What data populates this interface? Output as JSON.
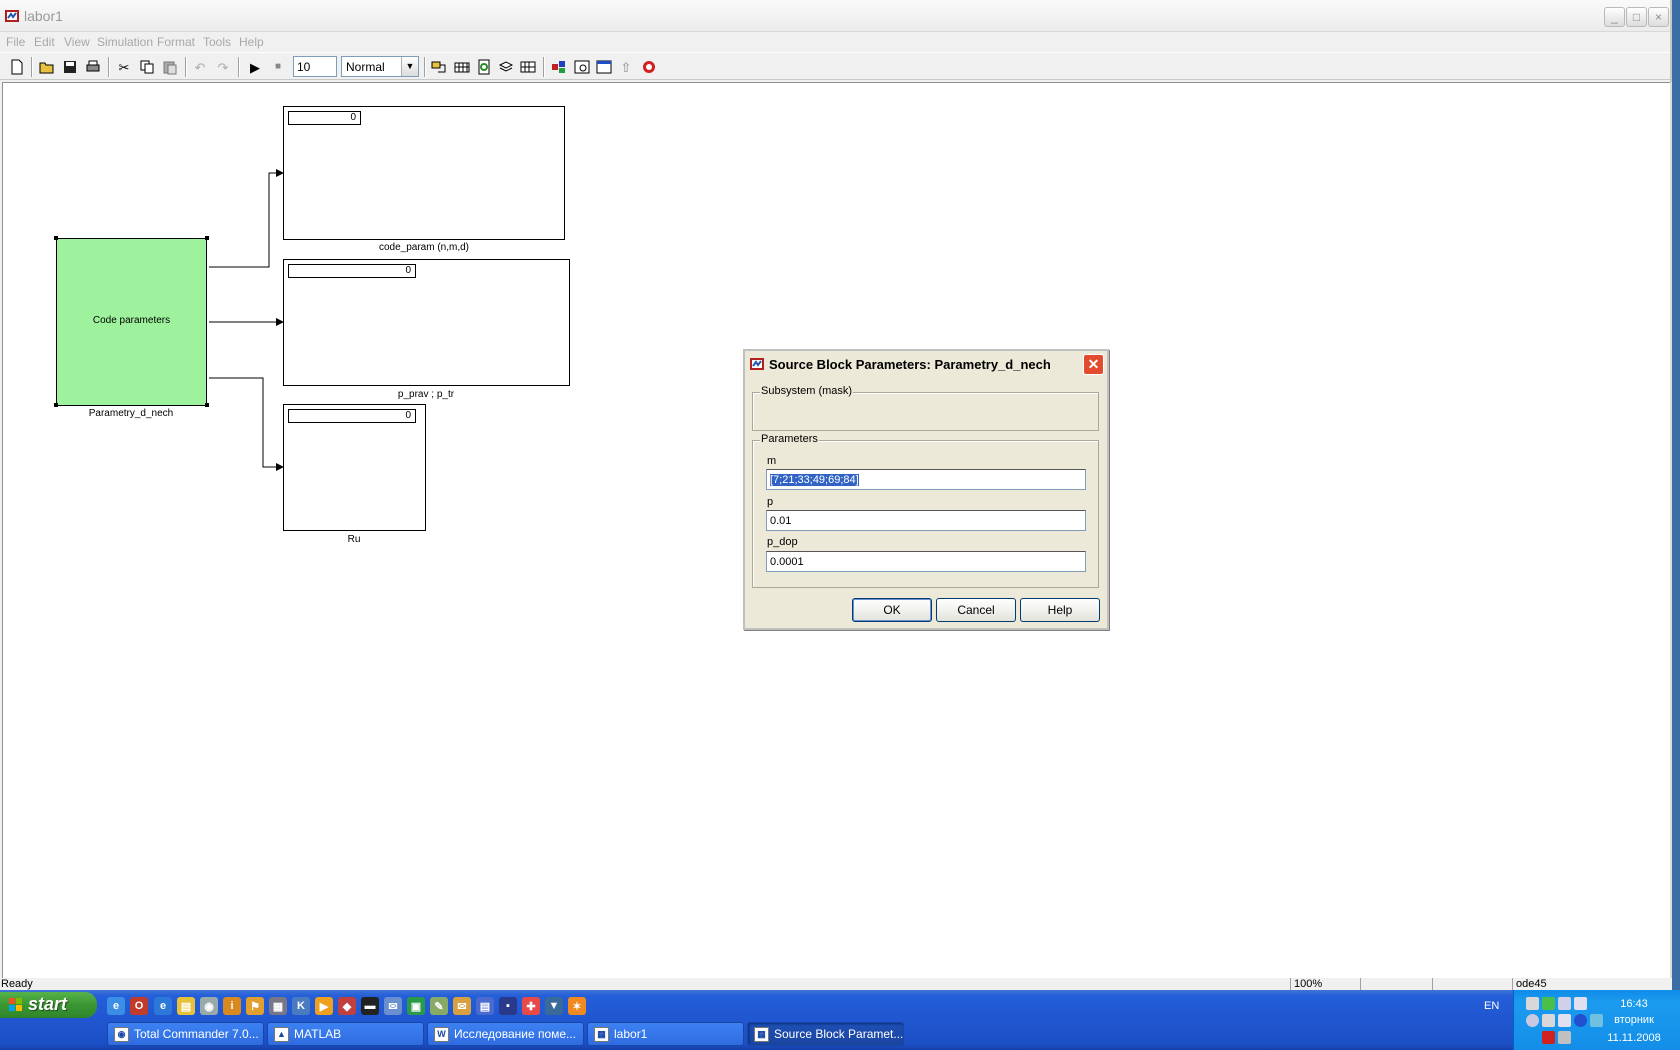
{
  "window": {
    "title": "labor1",
    "buttons": {
      "minimize": "_",
      "maximize": "□",
      "close": "×"
    }
  },
  "menu": [
    "File",
    "Edit",
    "View",
    "Simulation",
    "Format",
    "Tools",
    "Help"
  ],
  "toolbar": {
    "stop_time": "10",
    "sim_mode": "Normal"
  },
  "model": {
    "subsystem": {
      "text": "Code parameters",
      "name": "Parametry_d_nech",
      "color": "#9ef29e"
    },
    "displays": [
      {
        "name": "code_param (n,m,d)",
        "value": "0"
      },
      {
        "name": "p_prav ; p_tr",
        "value": "0"
      },
      {
        "name": "Ru",
        "value": "0"
      }
    ]
  },
  "status": {
    "text": "Ready",
    "zoom": "100%",
    "solver": "ode45"
  },
  "dialog": {
    "title": "Source Block Parameters: Parametry_d_nech",
    "group_subsystem": "Subsystem (mask)",
    "group_parameters": "Parameters",
    "params": [
      {
        "label": "m",
        "value": "[7;21;33;49;69;84]"
      },
      {
        "label": "p",
        "value": "0.01"
      },
      {
        "label": "p_dop",
        "value": "0.0001"
      }
    ],
    "buttons": {
      "ok": "OK",
      "cancel": "Cancel",
      "help": "Help"
    }
  },
  "taskbar": {
    "start": "start",
    "tasks": [
      "Total Commander 7.0...",
      "MATLAB",
      "Исследование поме...",
      "labor1",
      "Source Block Paramet..."
    ],
    "language": "EN",
    "time": "16:43",
    "weekday": "вторник",
    "date": "11.11.2008"
  }
}
